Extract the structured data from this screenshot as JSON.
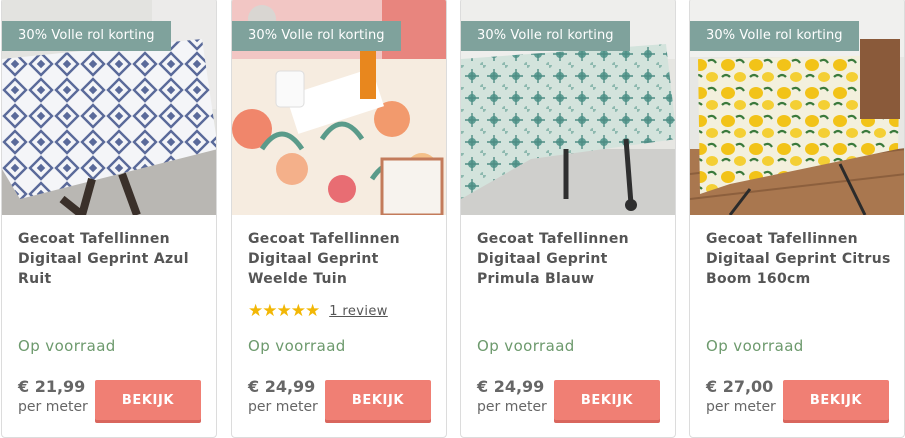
{
  "products": [
    {
      "badge": "30% Volle rol korting",
      "title": "Gecoat Tafellinnen Digitaal Geprint Azul Ruit",
      "stock": "Op voorraad",
      "price": "€ 21,99",
      "unit": "per meter",
      "button": "BEKIJK",
      "image": "tablecloth-blue-diamond-pattern"
    },
    {
      "badge": "30% Volle rol korting",
      "title": "Gecoat Tafellinnen Digitaal Geprint Weelde Tuin",
      "stars": "★★★★★",
      "rating": 5,
      "review": "1 review",
      "stock": "Op voorraad",
      "price": "€ 24,99",
      "unit": "per meter",
      "button": "BEKIJK",
      "image": "tablecloth-floral-garden"
    },
    {
      "badge": "30% Volle rol korting",
      "title": "Gecoat Tafellinnen Digitaal Geprint Primula Blauw",
      "stock": "Op voorraad",
      "price": "€ 24,99",
      "unit": "per meter",
      "button": "BEKIJK",
      "image": "tablecloth-green-primula"
    },
    {
      "badge": "30% Volle rol korting",
      "title": "Gecoat Tafellinnen Digitaal Geprint Citrus Boom 160cm",
      "stock": "Op voorraad",
      "price": "€ 27,00",
      "unit": "per meter",
      "button": "BEKIJK",
      "image": "tablecloth-lemon-tree"
    }
  ],
  "colors": {
    "badge": "#7fa29c",
    "button": "#f07f74",
    "stock": "#6d9a6d",
    "star": "#f2b705"
  }
}
